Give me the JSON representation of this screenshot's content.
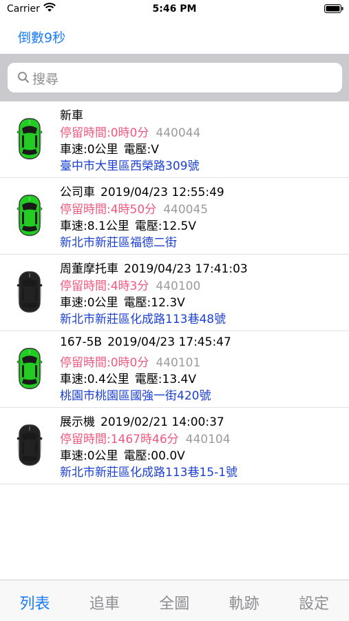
{
  "status_bar": {
    "carrier": "Carrier",
    "time": "5:46 PM",
    "wifi_icon": "wifi-icon",
    "battery_icon": "battery-icon"
  },
  "nav": {
    "countdown": "倒數9秒"
  },
  "search": {
    "placeholder": "搜尋",
    "icon": "search-icon"
  },
  "vehicles": [
    {
      "name": "新車",
      "datetime": "",
      "stay_label": "停留時間:",
      "stay": "0時0分",
      "device_id": "440044",
      "speed_label": "車速:",
      "speed": "0公里",
      "voltage_label": "電壓:",
      "voltage": "V",
      "address": "臺中市大里區西榮路309號",
      "color": "#22cc22",
      "icon": "green-car-icon"
    },
    {
      "name": "公司車",
      "datetime": "2019/04/23 12:55:49",
      "stay_label": "停留時間:",
      "stay": "4時50分",
      "device_id": "440045",
      "speed_label": "車速:",
      "speed": "8.1公里",
      "voltage_label": "電壓:",
      "voltage": "12.5V",
      "address": "新北市新莊區福德二街",
      "color": "#22cc22",
      "icon": "green-car-icon"
    },
    {
      "name": "周董摩托車",
      "datetime": "2019/04/23 17:41:03",
      "stay_label": "停留時間:",
      "stay": "4時3分",
      "device_id": "440100",
      "speed_label": "車速:",
      "speed": "0公里",
      "voltage_label": "電壓:",
      "voltage": "12.3V",
      "address": "新北市新莊區化成路113巷48號",
      "color": "#222222",
      "icon": "black-car-icon"
    },
    {
      "name": "167-5B",
      "datetime": "2019/04/23 17:45:47",
      "stay_label": "停留時間:",
      "stay": "0時0分",
      "device_id": "440101",
      "speed_label": "車速:",
      "speed": "0.4公里",
      "voltage_label": "電壓:",
      "voltage": "13.4V",
      "address": "桃園市桃園區國強一街420號",
      "color": "#22cc22",
      "icon": "green-car-icon"
    },
    {
      "name": "展示機",
      "datetime": "2019/02/21 14:00:37",
      "stay_label": "停留時間:",
      "stay": "1467時46分",
      "device_id": "440104",
      "speed_label": "車速:",
      "speed": "0公里",
      "voltage_label": "電壓:",
      "voltage": "00.0V",
      "address": "新北市新莊區化成路113巷15-1號",
      "color": "#222222",
      "icon": "black-car-icon"
    }
  ],
  "tabs": [
    {
      "label": "列表",
      "active": true
    },
    {
      "label": "追車",
      "active": false
    },
    {
      "label": "全圖",
      "active": false
    },
    {
      "label": "軌跡",
      "active": false
    },
    {
      "label": "設定",
      "active": false
    }
  ],
  "colors": {
    "accent": "#1a7cf5",
    "stay_time": "#f0587e",
    "address": "#1b3fd3",
    "device_id": "#9b9b9b"
  }
}
